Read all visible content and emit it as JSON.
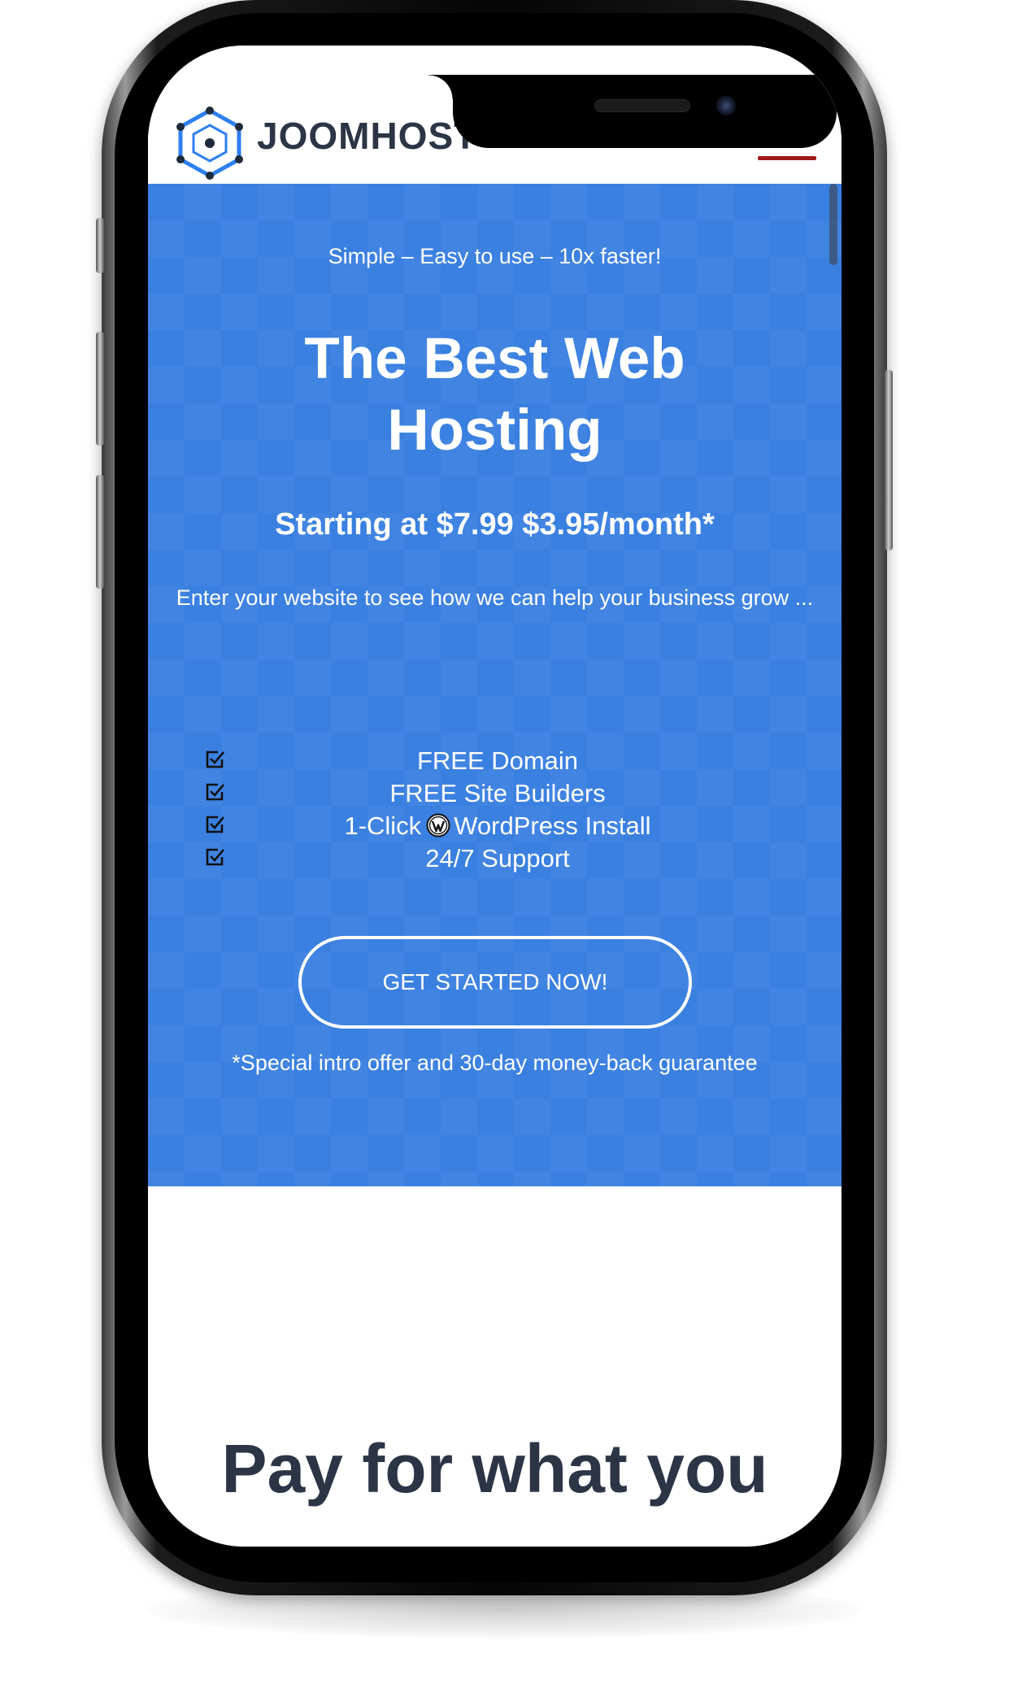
{
  "header": {
    "brand": "JOOMHOST",
    "logo_icon": "hexagon-logo-icon",
    "menu_icon": "hamburger-menu-icon",
    "menu_color": "#a01818"
  },
  "hero": {
    "background_color": "#3a80e1",
    "tagline": "Simple – Easy to use – 10x faster!",
    "headline": "The Best Web Hosting",
    "price": "Starting at $7.99 $3.95/month*",
    "intro": "Enter your website to see how we can help your business grow ...",
    "features": [
      {
        "icon": "checkbox-checked-icon",
        "text": "FREE Domain"
      },
      {
        "icon": "checkbox-checked-icon",
        "text": "FREE Site Builders"
      },
      {
        "icon": "checkbox-checked-icon",
        "text_before": "1-Click",
        "inline_icon": "wordpress-icon",
        "text_after": "WordPress Install"
      },
      {
        "icon": "checkbox-checked-icon",
        "text": "24/7 Support"
      }
    ],
    "cta_label": "GET STARTED NOW!",
    "offer_note": "*Special intro offer and 30-day money-back guarantee"
  },
  "section": {
    "heading": "Pay for what you"
  }
}
